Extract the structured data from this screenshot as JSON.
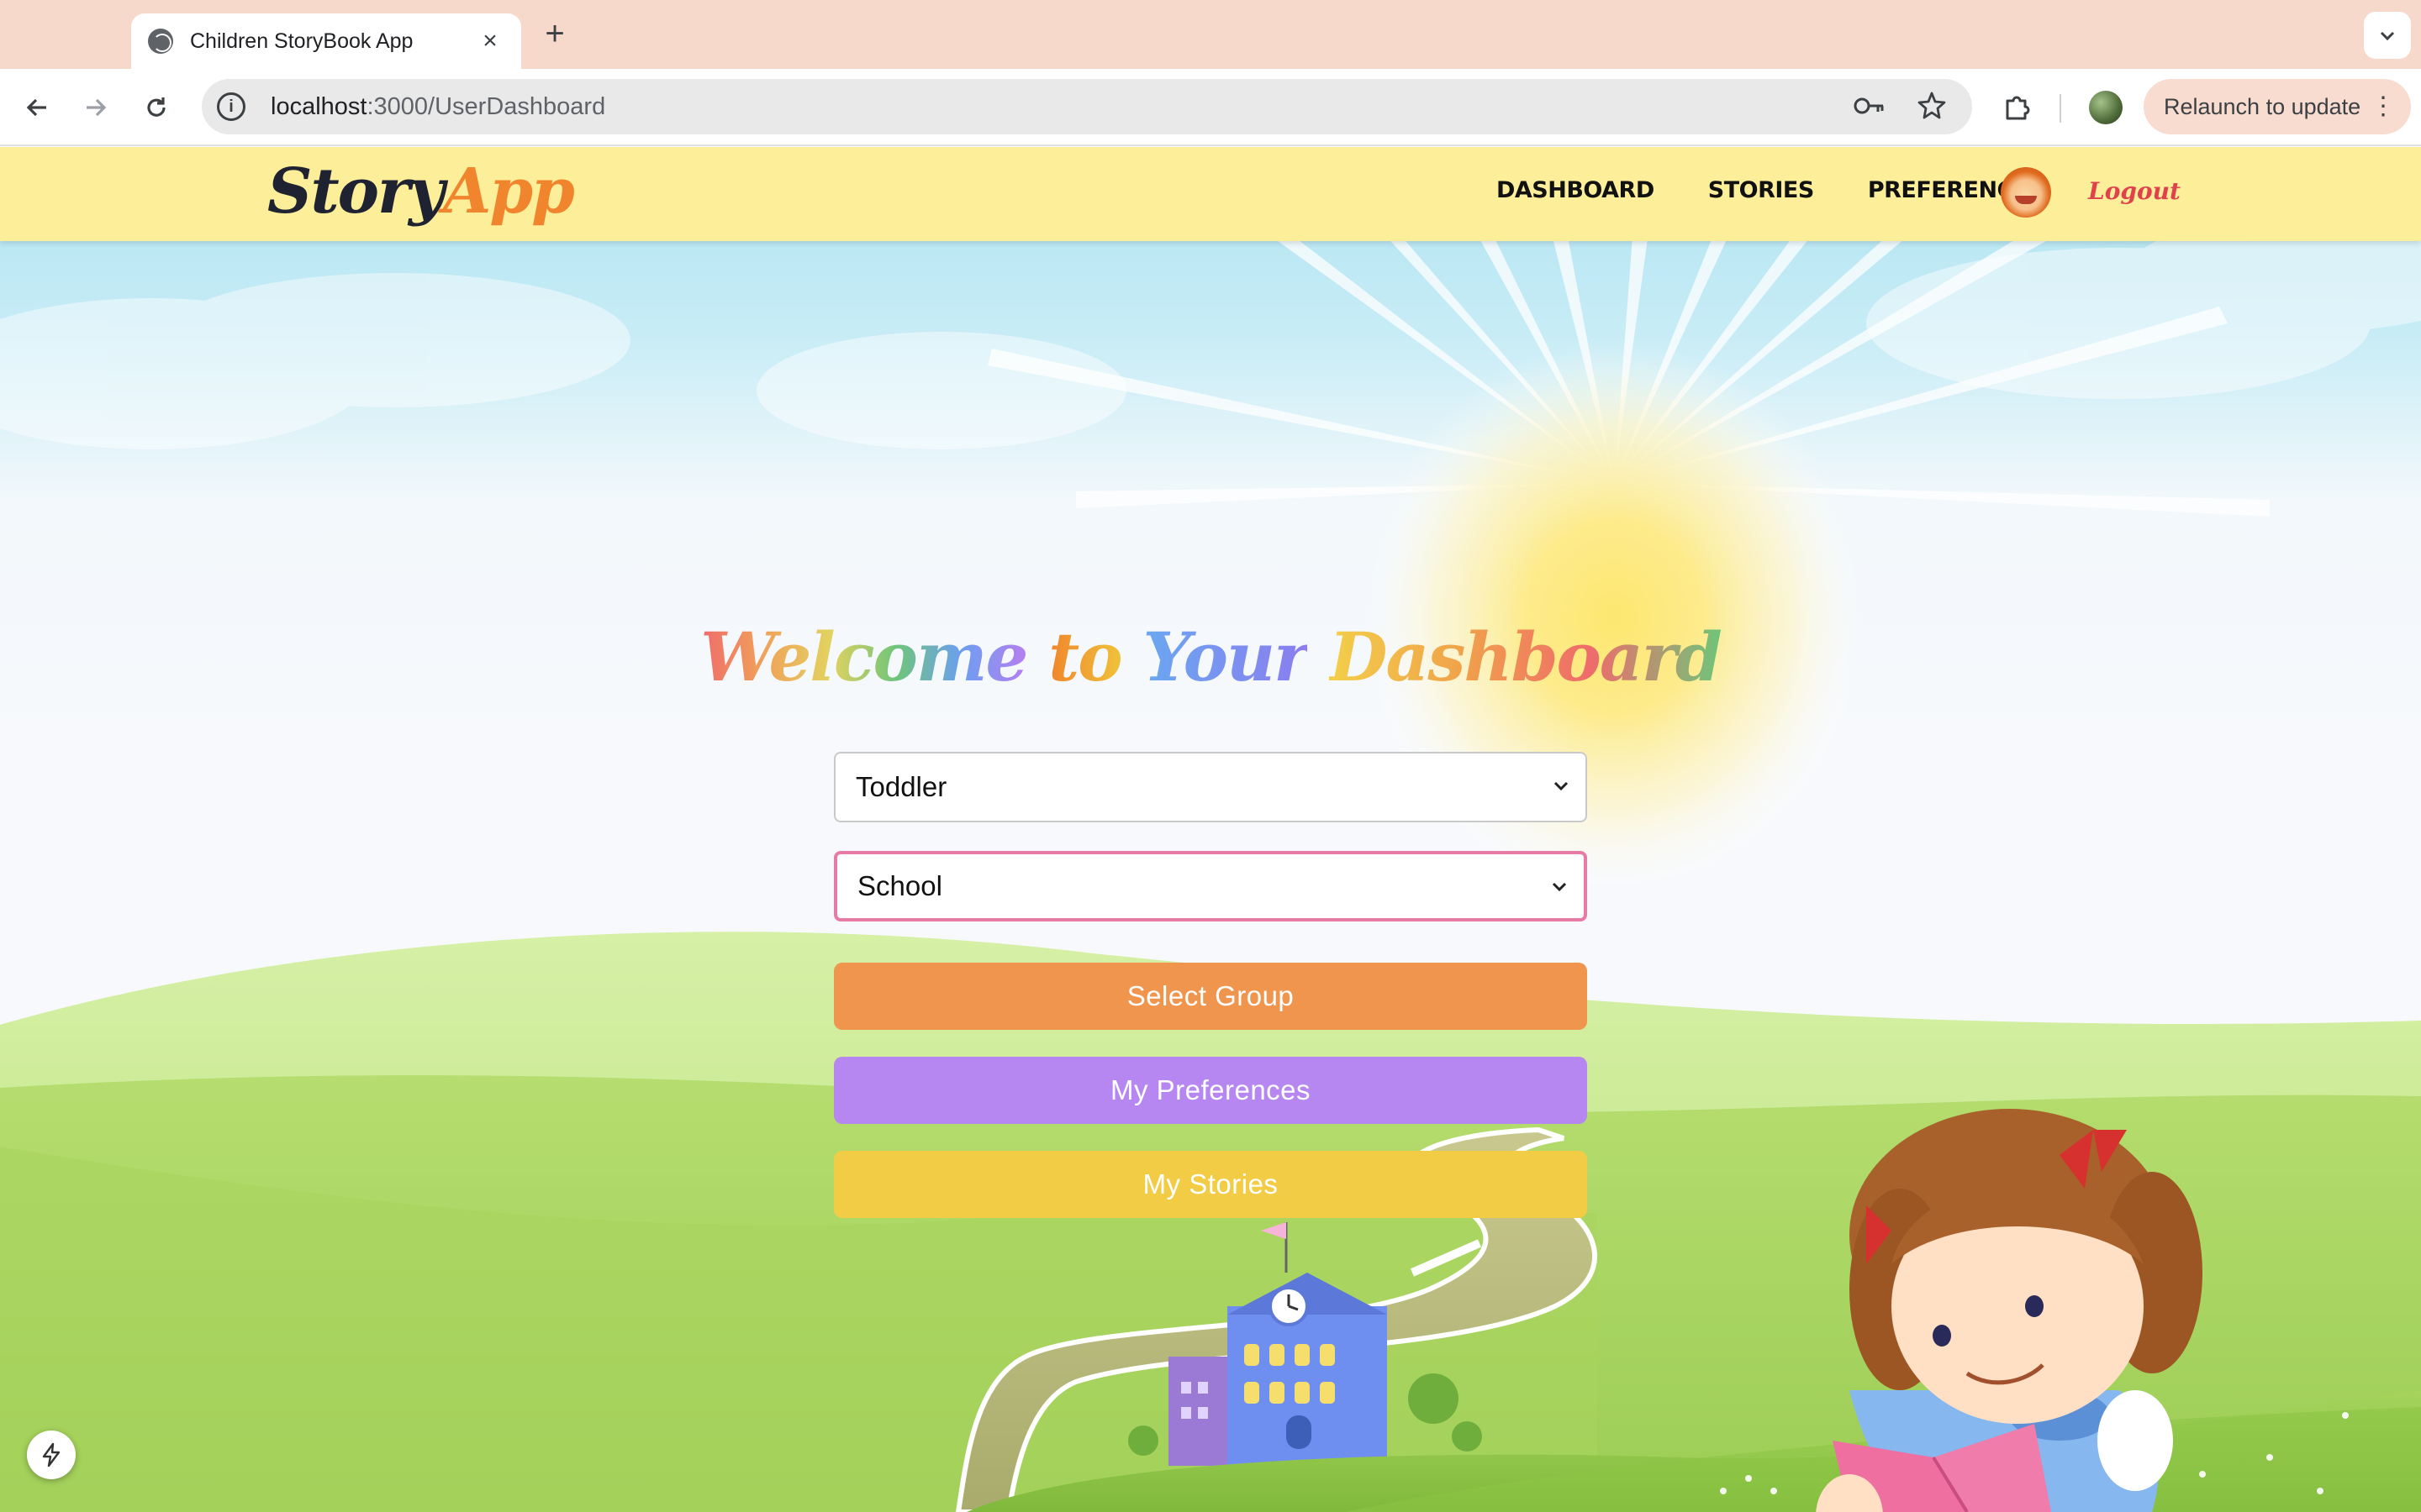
{
  "browser": {
    "tab_title": "Children StoryBook App",
    "url_host": "localhost",
    "url_path": ":3000/UserDashboard",
    "relaunch_label": "Relaunch to update"
  },
  "app": {
    "logo_part1": "Story",
    "logo_part2": "App",
    "nav": {
      "dashboard": "DASHBOARD",
      "stories": "STORIES",
      "preference": "PREFERENCE",
      "logout": "Logout"
    }
  },
  "dashboard": {
    "headline_words": [
      "Welcome",
      "to",
      "Your",
      "Dashboard"
    ],
    "age_select": "Toddler",
    "topic_select": "School",
    "select_group_label": "Select Group",
    "preferences_label": "My Preferences",
    "stories_label": "My Stories"
  },
  "colors": {
    "select_group": "#f0954d",
    "preferences": "#b687f0",
    "stories": "#f3cc45",
    "navbar": "#fdef9a",
    "logo_accent": "#f0852d",
    "logout": "#e0414b"
  }
}
